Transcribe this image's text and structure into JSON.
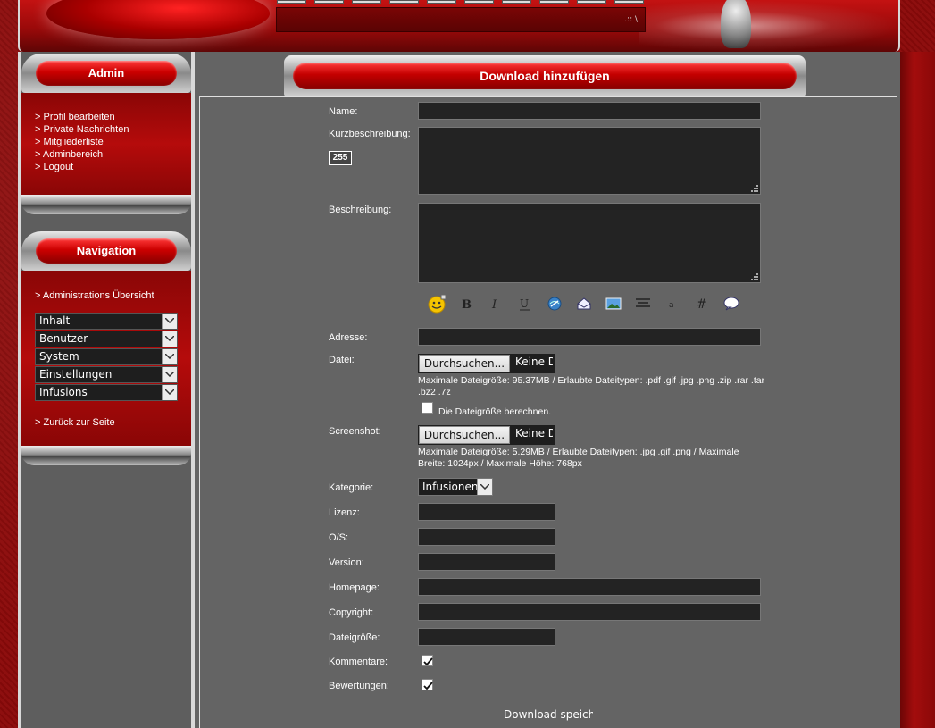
{
  "header": {
    "ticker": ".:: \\"
  },
  "sidebar": {
    "admin": {
      "title": "Admin",
      "links": [
        "> Profil bearbeiten",
        "> Private Nachrichten",
        "> Mitgliederliste",
        "> Adminbereich",
        "> Logout"
      ]
    },
    "navigation": {
      "title": "Navigation",
      "overview": "> Administrations Übersicht",
      "selects": [
        "Inhalt",
        "Benutzer",
        "System",
        "Einstellungen",
        "Infusions"
      ],
      "back": "> Zurück zur Seite"
    }
  },
  "main": {
    "title": "Download hinzufügen",
    "labels": {
      "name": "Name:",
      "short_desc": "Kurzbeschreibung:",
      "desc": "Beschreibung:",
      "address": "Adresse:",
      "file": "Datei:",
      "screenshot": "Screenshot:",
      "category": "Kategorie:",
      "license": "Lizenz:",
      "os": "O/S:",
      "version": "Version:",
      "homepage": "Homepage:",
      "copyright": "Copyright:",
      "filesize": "Dateigröße:",
      "comments": "Kommentare:",
      "ratings": "Bewertungen:"
    },
    "char_counter": "255",
    "file": {
      "browse_label": "Durchsuchen...",
      "none_label": "Keine Datei ausgewählt.",
      "hint": "Maximale Dateigröße: 95.37MB / Erlaubte Dateitypen: .pdf .gif .jpg .png .zip .rar .tar .bz2 .7z",
      "calc_size_label": "Die Dateigröße berechnen."
    },
    "screenshot": {
      "browse_label": "Durchsuchen...",
      "none_label": "Keine Datei ausgewählt.",
      "hint": "Maximale Dateigröße: 5.29MB / Erlaubte Dateitypen: .jpg .gif .png / Maximale Breite: 1024px / Maximale Höhe: 768px"
    },
    "category_value": "Infusionen",
    "comments_checked": true,
    "ratings_checked": true,
    "calc_size_checked": false,
    "save_label": "Download speichern",
    "bbcode_icons": [
      "smiley-icon",
      "bold-icon",
      "italic-icon",
      "underline-icon",
      "link-icon",
      "mail-icon",
      "image-icon",
      "center-icon",
      "small-text-icon",
      "code-icon",
      "quote-icon"
    ]
  }
}
